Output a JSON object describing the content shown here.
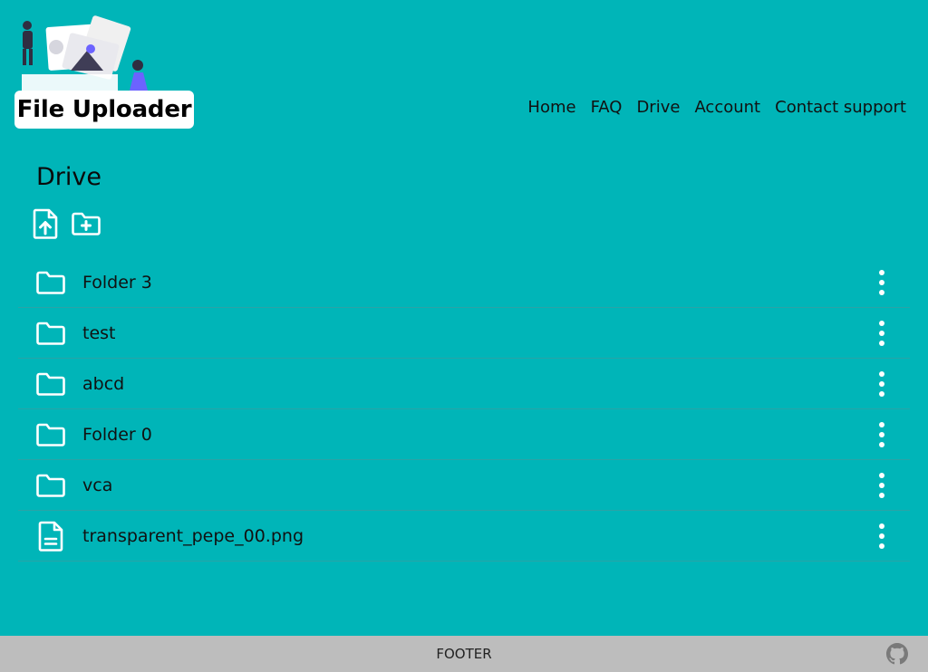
{
  "header": {
    "logo_text": "File Uploader",
    "nav": [
      {
        "label": "Home"
      },
      {
        "label": "FAQ"
      },
      {
        "label": "Drive"
      },
      {
        "label": "Account"
      },
      {
        "label": "Contact support"
      }
    ]
  },
  "main": {
    "title": "Drive",
    "toolbar": {
      "upload_icon": "file-upload-icon",
      "new_folder_icon": "folder-plus-icon"
    },
    "items": [
      {
        "name": "Folder 3",
        "type": "folder",
        "icon": "folder-icon"
      },
      {
        "name": "test",
        "type": "folder",
        "icon": "folder-icon"
      },
      {
        "name": "abcd",
        "type": "folder",
        "icon": "folder-icon"
      },
      {
        "name": "Folder 0",
        "type": "folder",
        "icon": "folder-icon"
      },
      {
        "name": "vca",
        "type": "folder",
        "icon": "folder-icon"
      },
      {
        "name": "transparent_pepe_00.png",
        "type": "file",
        "icon": "file-icon"
      }
    ]
  },
  "footer": {
    "label": "FOOTER",
    "github_icon": "github-icon"
  },
  "colors": {
    "background": "#00b5b8",
    "footer": "#bdbdbd",
    "icon": "#ffffff"
  }
}
